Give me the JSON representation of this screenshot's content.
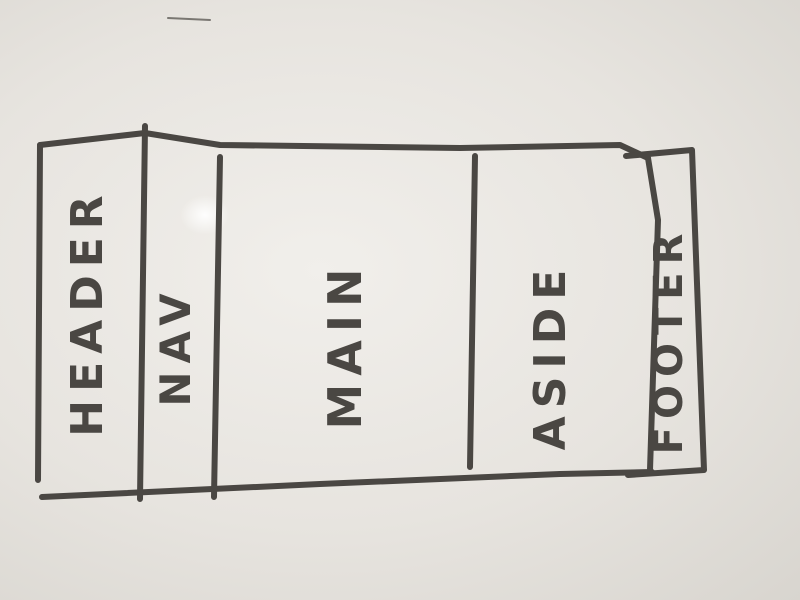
{
  "diagram": {
    "sections": [
      {
        "id": "header",
        "label": "HEADER"
      },
      {
        "id": "nav",
        "label": "NAV"
      },
      {
        "id": "main",
        "label": "MAIN"
      },
      {
        "id": "aside",
        "label": "ASIDE"
      },
      {
        "id": "footer",
        "label": "FOOTER"
      }
    ]
  },
  "colors": {
    "marker": "#4a4743",
    "board": "#e9e6e1"
  }
}
